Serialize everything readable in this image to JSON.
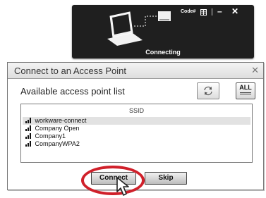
{
  "status_panel": {
    "code_label": "Code#",
    "minimize_label": "–",
    "close_label": "✕",
    "status_text": "Connecting"
  },
  "dialog": {
    "title": "Connect to an Access Point",
    "close_label": "✕",
    "list_title": "Available access point list",
    "all_label": "ALL",
    "column_header": "SSID",
    "networks": [
      {
        "ssid": "workware-connect",
        "selected": true
      },
      {
        "ssid": "Company Open",
        "selected": false
      },
      {
        "ssid": "Company1",
        "selected": false
      },
      {
        "ssid": "CompanyWPA2",
        "selected": false
      }
    ],
    "connect_label": "Connect",
    "skip_label": "Skip"
  },
  "colors": {
    "panel_bg": "#1f1f1f",
    "highlight_ring": "#d0202a",
    "selected_row": "#e2e2e2"
  }
}
